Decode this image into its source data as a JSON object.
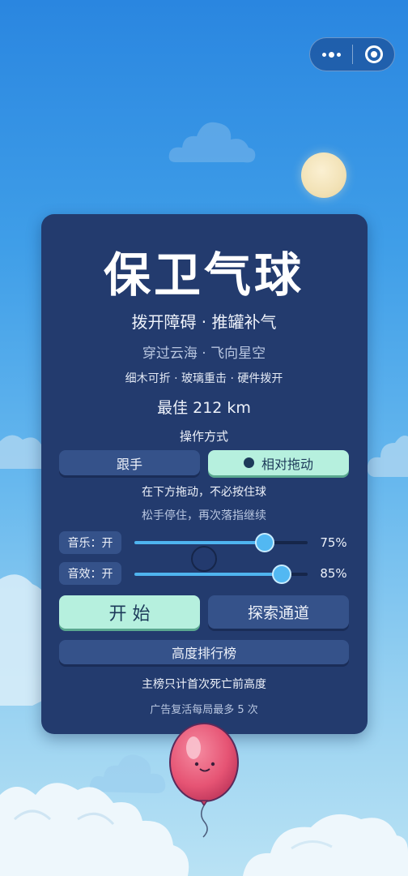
{
  "game": {
    "title": "保卫气球",
    "subtitle_1": "拨开障碍 · 推罐补气",
    "subtitle_2": "穿过云海 · 飞向星空",
    "subtitle_3": "细木可折 · 玻璃重击 · 硬件拨开",
    "best_score": "最佳 212 km"
  },
  "controls": {
    "label": "操作方式",
    "options": [
      {
        "label": "跟手",
        "selected": false
      },
      {
        "label": "相对拖动",
        "selected": true
      }
    ],
    "hint_1": "在下方拖动，不必按住球",
    "hint_2": "松手停住，再次落指继续"
  },
  "audio": {
    "music": {
      "label": "音乐：开",
      "value_text": "75%",
      "value": 0.75
    },
    "sfx": {
      "label": "音效：开",
      "value_text": "85%",
      "value": 0.85
    }
  },
  "actions": {
    "start_label": "开 始",
    "explore_label": "探索通道",
    "leaderboard_label": "高度排行榜"
  },
  "notes": {
    "note_1": "主榜只计首次死亡前高度",
    "note_2": "广告复活每局最多 5 次"
  },
  "colors": {
    "panel": "#233b6e",
    "accent_active": "#b6f0de",
    "slider": "#4fb4ef",
    "balloon": "#e85a78"
  }
}
